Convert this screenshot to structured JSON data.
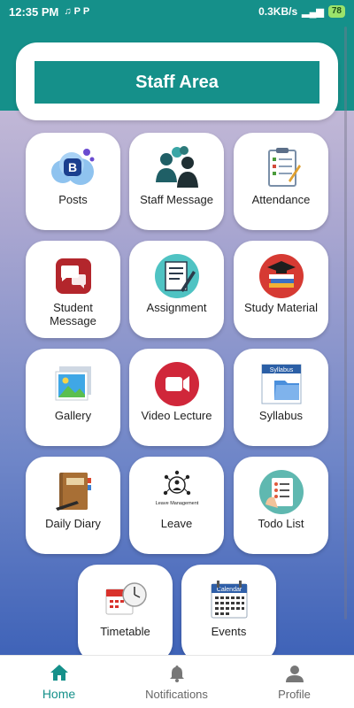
{
  "status_bar": {
    "time": "12:35 PM",
    "net_speed": "0.3KB/s",
    "battery": "78"
  },
  "header": {
    "title": "Staff Area"
  },
  "tiles": [
    {
      "label": "Posts",
      "icon": "blogger-icon"
    },
    {
      "label": "Staff Message",
      "icon": "people-chat-icon"
    },
    {
      "label": "Attendance",
      "icon": "attendance-clipboard-icon"
    },
    {
      "label": "Student\nMessage",
      "icon": "message-bubbles-icon"
    },
    {
      "label": "Assignment",
      "icon": "assignment-notepad-icon"
    },
    {
      "label": "Study Material",
      "icon": "graduation-books-icon"
    },
    {
      "label": "Gallery",
      "icon": "gallery-picture-icon"
    },
    {
      "label": "Video Lecture",
      "icon": "video-camera-icon"
    },
    {
      "label": "Syllabus",
      "icon": "syllabus-folder-icon"
    },
    {
      "label": "Daily Diary",
      "icon": "diary-book-icon"
    },
    {
      "label": "Leave",
      "icon": "leave-management-icon"
    },
    {
      "label": "Todo List",
      "icon": "todo-list-icon"
    },
    {
      "label": "Timetable",
      "icon": "calendar-clock-icon"
    },
    {
      "label": "Events",
      "icon": "calendar-icon"
    }
  ],
  "leave_icon_caption": "Leave Management",
  "syllabus_icon_caption": "Syllabus",
  "calendar_icon_caption": "Calendar",
  "nav": {
    "items": [
      {
        "label": "Home",
        "icon": "home-icon"
      },
      {
        "label": "Notifications",
        "icon": "bell-icon"
      },
      {
        "label": "Profile",
        "icon": "person-icon"
      }
    ],
    "active_color": "#15908a"
  },
  "colors": {
    "accent": "#15908a"
  }
}
